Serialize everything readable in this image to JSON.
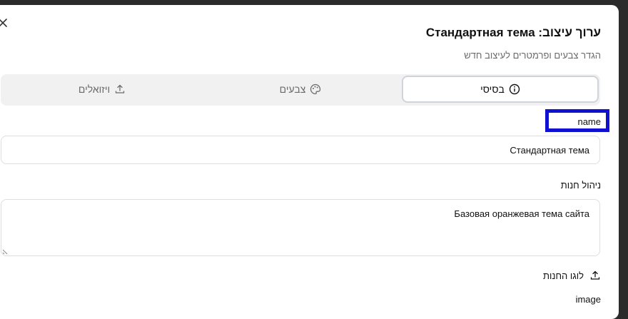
{
  "dialog": {
    "title": "ערוך עיצוב: Стандартная тема",
    "subtitle": "הגדר צבעים ופרמטרים לעיצוב חדש"
  },
  "tabs": [
    {
      "label": "בסיסי",
      "icon": "info-icon",
      "active": true
    },
    {
      "label": "צבעים",
      "icon": "palette-icon",
      "active": false
    },
    {
      "label": "ויזואלים",
      "icon": "upload-icon",
      "active": false
    }
  ],
  "form": {
    "name_label": "name",
    "name_value": "Стандартная тема",
    "description_label": "ניהול חנות",
    "description_value": "Базовая оранжевая тема сайта",
    "logo_label": "לוגו החנות",
    "image_label": "image"
  },
  "colors": {
    "highlight": "#1010d0",
    "backdrop": "#2b2b2b"
  }
}
